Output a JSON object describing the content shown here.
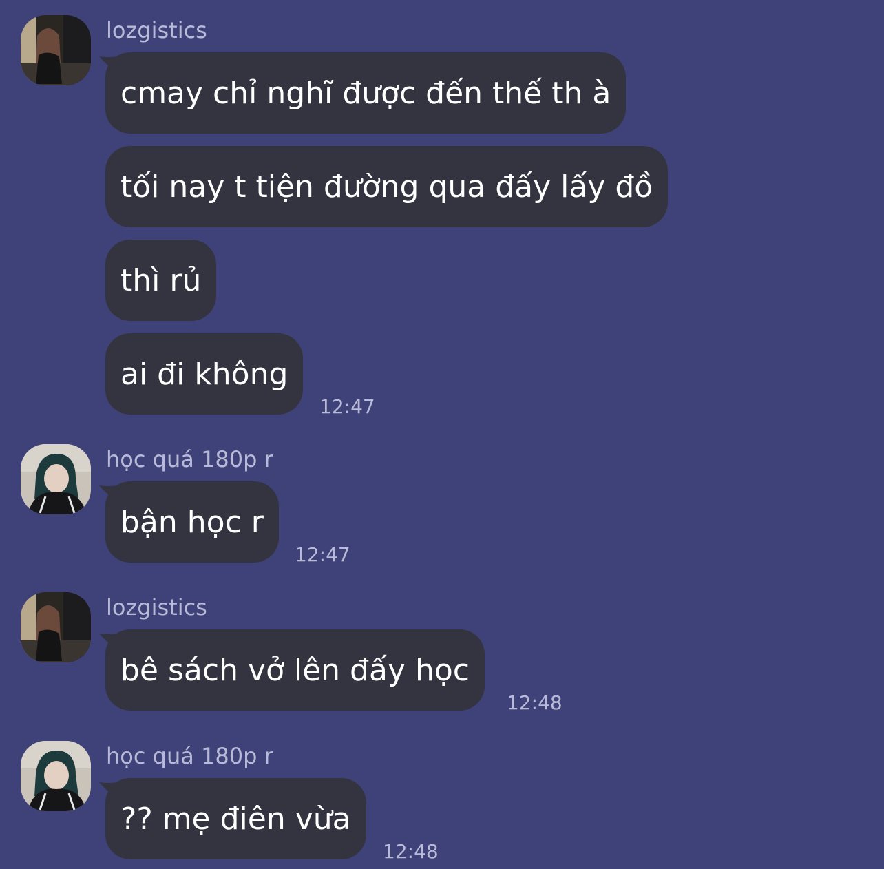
{
  "colors": {
    "background": "#3f4278",
    "bubble": "#343440",
    "message_text": "#ffffff",
    "meta_text": "#b9bad8"
  },
  "groups": [
    {
      "sender": "lozgistics",
      "avatar": "avatar-lozgistics",
      "messages": [
        "cmay chỉ nghĩ được đến thế th à",
        "tối nay t tiện đường qua đấy lấy đồ",
        "thì rủ",
        "ai đi không"
      ],
      "time": "12:47"
    },
    {
      "sender": "học quá 180p r",
      "avatar": "avatar-hoc-qua",
      "messages": [
        "bận học r"
      ],
      "time": "12:47"
    },
    {
      "sender": "lozgistics",
      "avatar": "avatar-lozgistics",
      "messages": [
        "bê sách vở lên đấy học"
      ],
      "time": "12:48"
    },
    {
      "sender": "học quá 180p r",
      "avatar": "avatar-hoc-qua",
      "messages": [
        "?? mẹ điên vừa"
      ],
      "time": "12:48"
    }
  ]
}
